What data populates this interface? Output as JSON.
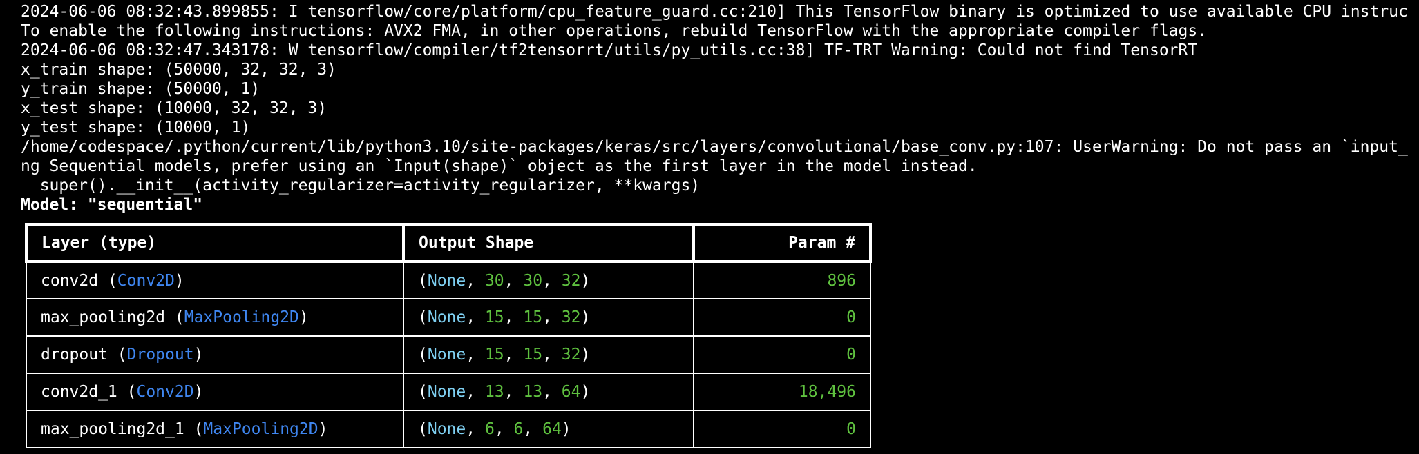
{
  "log_lines": [
    "2024-06-06 08:32:43.899855: I tensorflow/core/platform/cpu_feature_guard.cc:210] This TensorFlow binary is optimized to use available CPU instruc",
    "To enable the following instructions: AVX2 FMA, in other operations, rebuild TensorFlow with the appropriate compiler flags.",
    "2024-06-06 08:32:47.343178: W tensorflow/compiler/tf2tensorrt/utils/py_utils.cc:38] TF-TRT Warning: Could not find TensorRT",
    "x_train shape: (50000, 32, 32, 3)",
    "y_train shape: (50000, 1)",
    "x_test shape: (10000, 32, 32, 3)",
    "y_test shape: (10000, 1)",
    "/home/codespace/.python/current/lib/python3.10/site-packages/keras/src/layers/convolutional/base_conv.py:107: UserWarning: Do not pass an `input_",
    "ng Sequential models, prefer using an `Input(shape)` object as the first layer in the model instead.",
    "  super().__init__(activity_regularizer=activity_regularizer, **kwargs)"
  ],
  "model_title": "Model: \"sequential\"",
  "table": {
    "headers": {
      "layer": "Layer (type)",
      "output": "Output Shape",
      "params": "Param #"
    },
    "rows": [
      {
        "name": "conv2d",
        "type": "Conv2D",
        "shape": [
          "None",
          "30",
          "30",
          "32"
        ],
        "params": "896"
      },
      {
        "name": "max_pooling2d",
        "type": "MaxPooling2D",
        "shape": [
          "None",
          "15",
          "15",
          "32"
        ],
        "params": "0"
      },
      {
        "name": "dropout",
        "type": "Dropout",
        "shape": [
          "None",
          "15",
          "15",
          "32"
        ],
        "params": "0"
      },
      {
        "name": "conv2d_1",
        "type": "Conv2D",
        "shape": [
          "None",
          "13",
          "13",
          "64"
        ],
        "params": "18,496"
      },
      {
        "name": "max_pooling2d_1",
        "type": "MaxPooling2D",
        "shape": [
          "None",
          "6",
          "6",
          "64"
        ],
        "params": "0"
      }
    ]
  },
  "colors": {
    "background": "#000000",
    "text": "#ffffff",
    "layer_type": "#3f86f0",
    "none_keyword": "#7fd0f2",
    "number": "#5fc13f"
  }
}
